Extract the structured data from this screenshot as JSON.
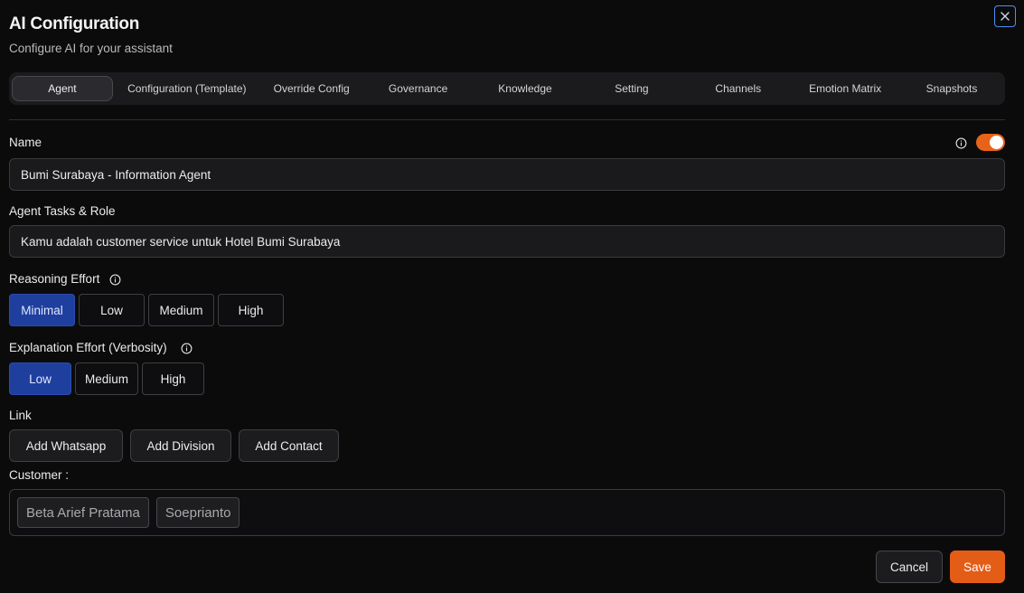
{
  "header": {
    "title": "AI Configuration",
    "subtitle": "Configure AI for your assistant",
    "close_icon": "close-icon"
  },
  "tabs": [
    {
      "label": "Agent",
      "active": true
    },
    {
      "label": "Configuration (Template)",
      "active": false
    },
    {
      "label": "Override Config",
      "active": false
    },
    {
      "label": "Governance",
      "active": false
    },
    {
      "label": "Knowledge",
      "active": false
    },
    {
      "label": "Setting",
      "active": false
    },
    {
      "label": "Channels",
      "active": false
    },
    {
      "label": "Emotion Matrix",
      "active": false
    },
    {
      "label": "Snapshots",
      "active": false
    }
  ],
  "name": {
    "label": "Name",
    "value": "Bumi Surabaya - Information Agent",
    "toggle_on": true
  },
  "role": {
    "label": "Agent Tasks & Role",
    "value": "Kamu adalah customer service untuk Hotel Bumi Surabaya"
  },
  "reasoning": {
    "label": "Reasoning Effort",
    "options": [
      "Minimal",
      "Low",
      "Medium",
      "High"
    ],
    "selected": "Minimal"
  },
  "explanation": {
    "label": "Explanation Effort (Verbosity)",
    "options": [
      "Low",
      "Medium",
      "High"
    ],
    "selected": "Low"
  },
  "link": {
    "label": "Link",
    "buttons": [
      "Add Whatsapp",
      "Add Division",
      "Add Contact"
    ]
  },
  "customer": {
    "label": "Customer :",
    "chips": [
      "Beta Arief Pratama",
      "Soeprianto"
    ]
  },
  "footer": {
    "cancel_label": "Cancel",
    "save_label": "Save"
  },
  "colors": {
    "accent": "#e35d17",
    "selected": "#1f3f9e",
    "close_border": "#4f8df0"
  }
}
